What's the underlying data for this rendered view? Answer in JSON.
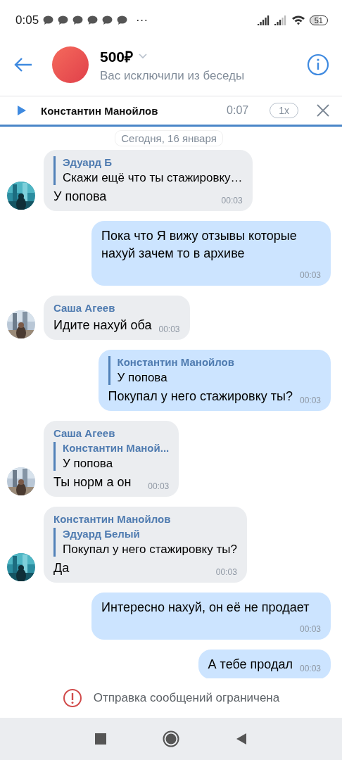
{
  "status_bar": {
    "time": "0:05",
    "more": "···",
    "battery": "51"
  },
  "header": {
    "title": "500₽",
    "subtitle": "Вас исключили из беседы"
  },
  "player": {
    "name": "Константин Манойлов",
    "duration": "0:07",
    "speed": "1x",
    "playing": false
  },
  "date_pill": "Сегодня, 16 января",
  "messages": [
    {
      "kind": "in",
      "reply": {
        "name": "Эдуард Б",
        "text": "Скажи ещё что ты стажировку…"
      },
      "text": "У попова",
      "time": "00:03"
    },
    {
      "kind": "out",
      "text": "Пока что Я вижу отзывы которые нахуй зачем то в архиве",
      "time": "00:03"
    },
    {
      "kind": "in",
      "sender": "Саша Агеев",
      "text": "Идите нахуй оба",
      "time": "00:03"
    },
    {
      "kind": "out",
      "reply": {
        "name": "Константин Манойлов",
        "text": "У попова"
      },
      "text": "Покупал у него стажировку ты?",
      "time": "00:03"
    },
    {
      "kind": "in",
      "sender": "Саша Агеев",
      "reply": {
        "name": "Константин Маной...",
        "text": "У попова"
      },
      "text": "Ты норм а он",
      "time": "00:03"
    },
    {
      "kind": "in",
      "sender": "Константин Манойлов",
      "reply": {
        "name": "Эдуард Белый",
        "text": "Покупал у него стажировку ты?"
      },
      "text": "Да",
      "time": "00:03"
    },
    {
      "kind": "out",
      "text": "Интересно нахуй, он её не продает",
      "time": "00:03"
    },
    {
      "kind": "out",
      "text": "А тебе продал",
      "time": "00:03"
    }
  ],
  "restriction": "Отправка сообщений ограничена"
}
